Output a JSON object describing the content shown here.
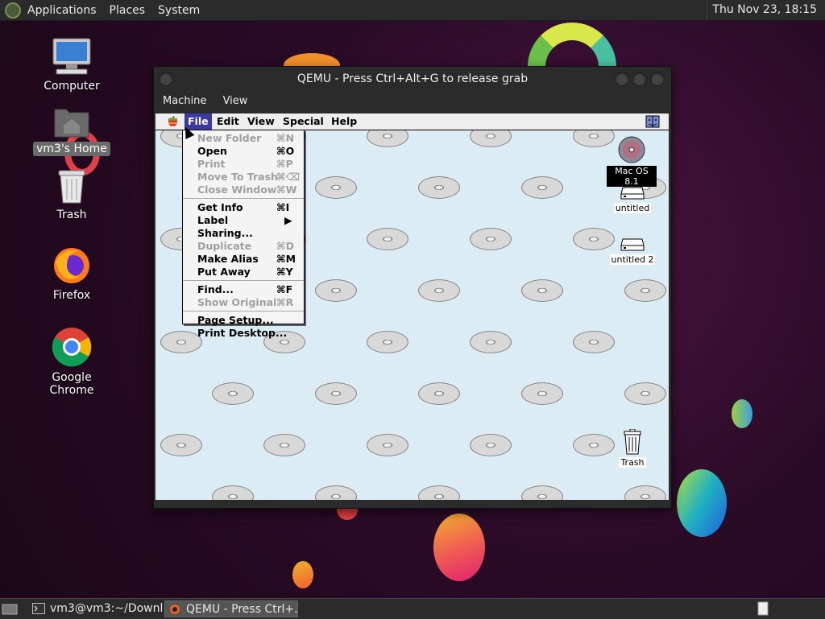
{
  "top_panel": {
    "menus": [
      "Applications",
      "Places",
      "System"
    ],
    "clock": "Thu Nov 23, 18:15"
  },
  "desktop_icons": [
    {
      "label": "Computer",
      "icon": "computer-icon"
    },
    {
      "label": "vm3's Home",
      "icon": "home-folder-icon",
      "selected": true
    },
    {
      "label": "Trash",
      "icon": "trash-icon"
    },
    {
      "label": "Firefox",
      "icon": "firefox-icon"
    },
    {
      "label": "Google Chrome",
      "icon": "chrome-icon"
    }
  ],
  "qemu": {
    "title": "QEMU - Press Ctrl+Alt+G to release grab",
    "menus": [
      "Machine",
      "View"
    ]
  },
  "mac": {
    "menus": [
      "File",
      "Edit",
      "View",
      "Special",
      "Help"
    ],
    "active_menu": "File",
    "file_menu": {
      "items": [
        {
          "label": "New Folder",
          "key": "⌘N",
          "enabled": false
        },
        {
          "label": "Open",
          "key": "⌘O",
          "enabled": true
        },
        {
          "label": "Print",
          "key": "⌘P",
          "enabled": false
        },
        {
          "label": "Move To Trash",
          "key": "⌘⌫",
          "enabled": false
        },
        {
          "label": "Close Window",
          "key": "⌘W",
          "enabled": false
        },
        {
          "label": "Get Info",
          "key": "⌘I",
          "enabled": true
        },
        {
          "label": "Label",
          "key": "▶",
          "enabled": true
        },
        {
          "label": "Sharing...",
          "key": "",
          "enabled": true
        },
        {
          "label": "Duplicate",
          "key": "⌘D",
          "enabled": false
        },
        {
          "label": "Make Alias",
          "key": "⌘M",
          "enabled": true
        },
        {
          "label": "Put Away",
          "key": "⌘Y",
          "enabled": true
        },
        {
          "label": "Find...",
          "key": "⌘F",
          "enabled": true
        },
        {
          "label": "Show Original",
          "key": "⌘R",
          "enabled": false
        },
        {
          "label": "Page Setup...",
          "key": "",
          "enabled": true
        },
        {
          "label": "Print Desktop...",
          "key": "",
          "enabled": true
        }
      ]
    },
    "desktop_icons": [
      {
        "label": "Mac OS 8.1",
        "icon": "cd-disk-icon",
        "selected": true
      },
      {
        "label": "untitled",
        "icon": "hard-disk-icon"
      },
      {
        "label": "untitled 2",
        "icon": "hard-disk-icon"
      },
      {
        "label": "Trash",
        "icon": "mac-trash-icon"
      }
    ]
  },
  "taskbar": {
    "tasks": [
      {
        "label": "vm3@vm3:~/Downl...",
        "icon": "terminal-icon"
      },
      {
        "label": "QEMU - Press Ctrl+...",
        "icon": "qemu-icon",
        "active": true
      }
    ]
  }
}
